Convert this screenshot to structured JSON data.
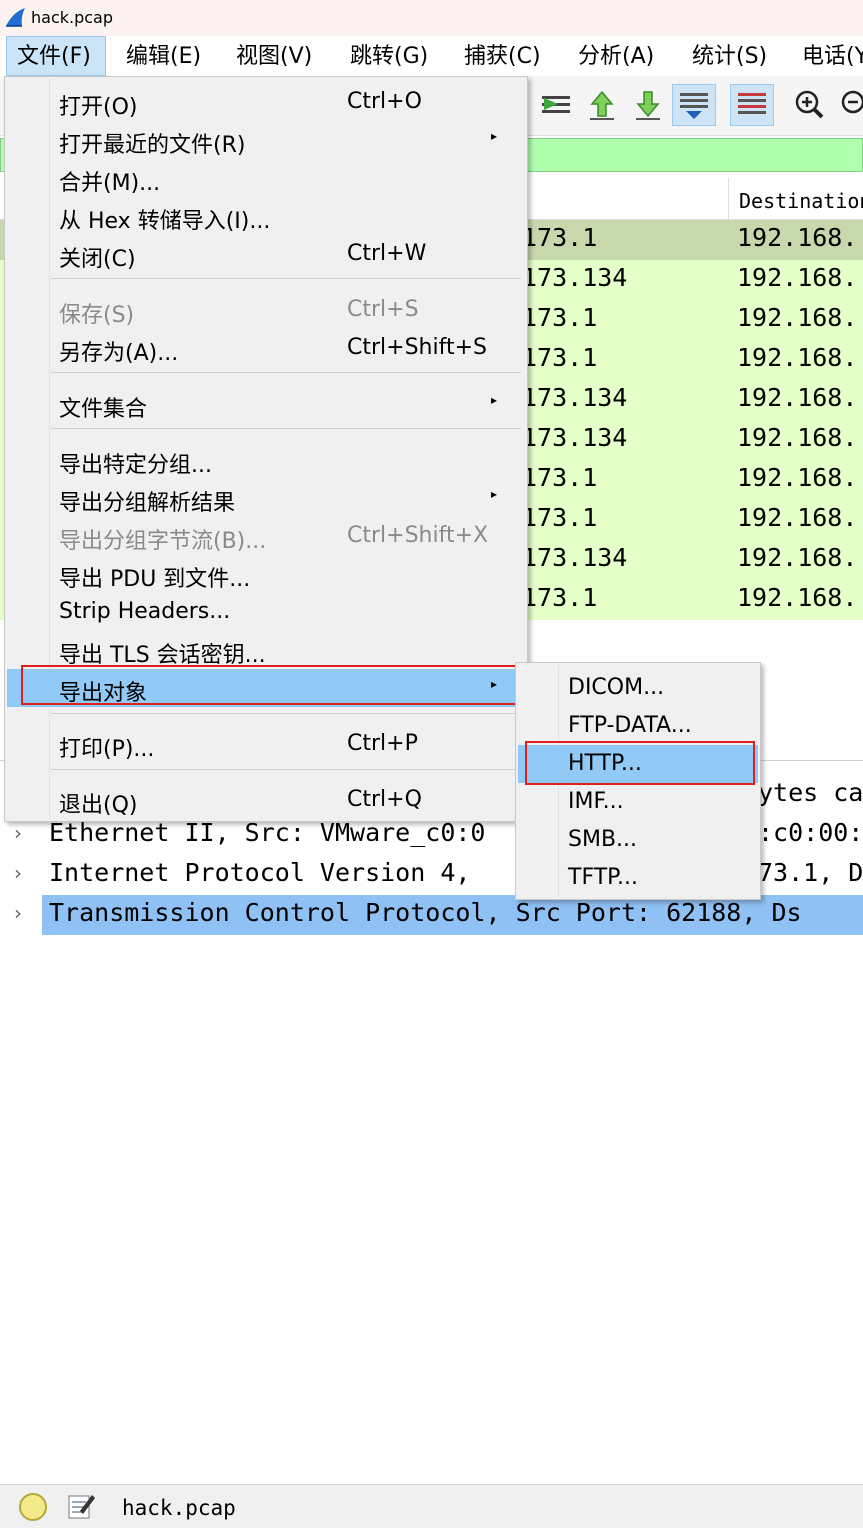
{
  "window": {
    "title": "hack.pcap"
  },
  "menubar": [
    "文件(F)",
    "编辑(E)",
    "视图(V)",
    "跳转(G)",
    "捕获(C)",
    "分析(A)",
    "统计(S)",
    "电话(Y)"
  ],
  "packet_list": {
    "column_destination": "Destination",
    "rows": [
      {
        "src": "173.1",
        "dst": "192.168."
      },
      {
        "src": "173.134",
        "dst": "192.168."
      },
      {
        "src": "173.1",
        "dst": "192.168."
      },
      {
        "src": "173.1",
        "dst": "192.168."
      },
      {
        "src": "173.134",
        "dst": "192.168."
      },
      {
        "src": "173.134",
        "dst": "192.168."
      },
      {
        "src": "173.1",
        "dst": "192.168."
      },
      {
        "src": "173.1",
        "dst": "192.168."
      },
      {
        "src": "173.134",
        "dst": "192.168."
      },
      {
        "src": "173.1",
        "dst": "192.168."
      }
    ]
  },
  "details": {
    "frame_tail": "ytes ca",
    "ethernet": "Ethernet II, Src: VMware_c0:0",
    "ethernet_tail": ":c0:00:",
    "ip": "Internet Protocol Version 4,",
    "ip_tail": "73.1, D",
    "tcp": "Transmission Control Protocol, Src Port: 62188, Ds"
  },
  "file_menu": {
    "open": {
      "label": "打开(O)",
      "shortcut": "Ctrl+O"
    },
    "open_recent": {
      "label": "打开最近的文件(R)"
    },
    "merge": {
      "label": "合并(M)..."
    },
    "import_hex": {
      "label": "从 Hex 转储导入(I)..."
    },
    "close": {
      "label": "关闭(C)",
      "shortcut": "Ctrl+W"
    },
    "save": {
      "label": "保存(S)",
      "shortcut": "Ctrl+S"
    },
    "save_as": {
      "label": "另存为(A)...",
      "shortcut": "Ctrl+Shift+S"
    },
    "file_set": {
      "label": "文件集合"
    },
    "export_specified": {
      "label": "导出特定分组..."
    },
    "export_dissections": {
      "label": "导出分组解析结果"
    },
    "export_bytes": {
      "label": "导出分组字节流(B)...",
      "shortcut": "Ctrl+Shift+X"
    },
    "export_pdu": {
      "label": "导出 PDU 到文件..."
    },
    "strip_headers": {
      "label": "Strip Headers..."
    },
    "export_tls": {
      "label": "导出 TLS 会话密钥..."
    },
    "export_objects": {
      "label": "导出对象"
    },
    "print": {
      "label": "打印(P)...",
      "shortcut": "Ctrl+P"
    },
    "quit": {
      "label": "退出(Q)",
      "shortcut": "Ctrl+Q"
    }
  },
  "export_objects_submenu": [
    "DICOM...",
    "FTP-DATA...",
    "HTTP...",
    "IMF...",
    "SMB...",
    "TFTP..."
  ],
  "statusbar": {
    "file": "hack.pcap"
  }
}
